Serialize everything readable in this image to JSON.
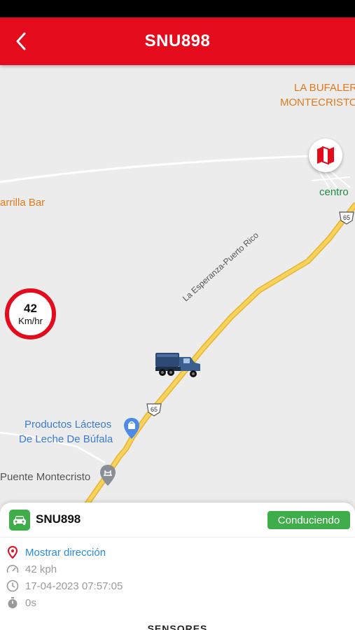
{
  "header": {
    "title": "SNU898",
    "back_icon": "chevron-left-icon",
    "background": "#e30b1c"
  },
  "map": {
    "labels": {
      "bufalera_line1": "LA BUFALER",
      "bufalera_line2": "MONTECRISTO",
      "parrilla": "arrilla Bar",
      "centro": "centro",
      "road_name": "La Esperanza-Puerto Rico",
      "productos_line1": "Productos Lácteos",
      "productos_line2": "De Leche De Búfala",
      "puente": "Puente Montecristo",
      "route_shield_top": "65",
      "route_shield_mid": "65"
    },
    "map_type_icon": "map-icon",
    "speed": {
      "value": "42",
      "unit": "Km/hr"
    },
    "vehicle_icon": "truck-icon"
  },
  "panel": {
    "vehicle_icon": "car-icon",
    "vehicle_name": "SNU898",
    "status": "Conduciendo",
    "status_color": "#3fae4a",
    "address_link": "Mostrar dirección",
    "speed": "42 kph",
    "datetime": "17-04-2023 07:57:05",
    "stopped_time": "0s",
    "section_title": "SENSORES"
  }
}
